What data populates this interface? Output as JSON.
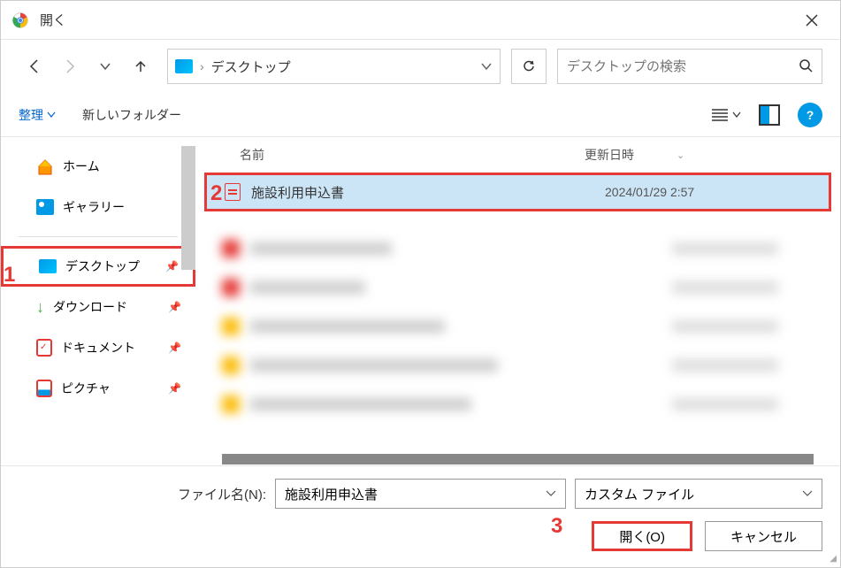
{
  "window": {
    "title": "開く"
  },
  "breadcrumb": {
    "separator": "›",
    "location": "デスクトップ"
  },
  "search": {
    "placeholder": "デスクトップの検索"
  },
  "toolbar": {
    "organize": "整理",
    "new_folder": "新しいフォルダー"
  },
  "sidebar": {
    "home": "ホーム",
    "gallery": "ギャラリー",
    "desktop": "デスクトップ",
    "downloads": "ダウンロード",
    "documents": "ドキュメント",
    "pictures": "ピクチャ"
  },
  "columns": {
    "name": "名前",
    "date": "更新日時"
  },
  "files": [
    {
      "name": "施設利用申込書",
      "date": "2024/01/29 2:57"
    }
  ],
  "footer": {
    "filename_label": "ファイル名(N):",
    "filename_value": "施設利用申込書",
    "filter": "カスタム ファイル",
    "open": "開く(O)",
    "cancel": "キャンセル"
  },
  "annotations": {
    "a1": "1",
    "a2": "2",
    "a3": "3"
  }
}
